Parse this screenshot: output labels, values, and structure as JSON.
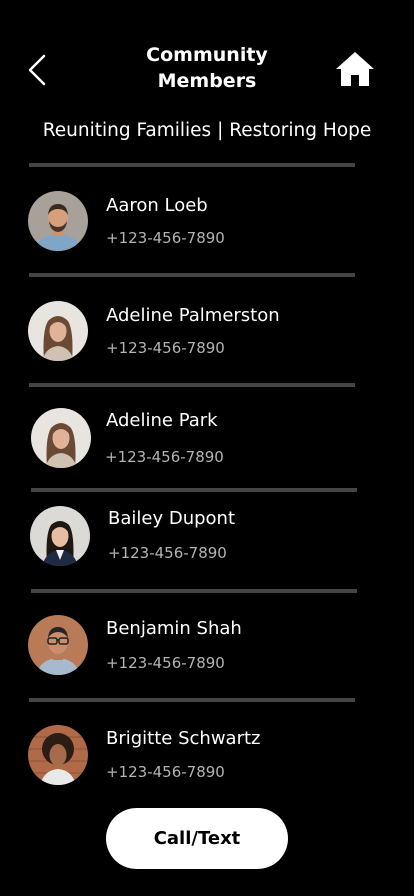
{
  "header": {
    "title_line1": "Community",
    "title_line2": "Members",
    "back_icon": "chevron-left-icon",
    "home_icon": "home-icon"
  },
  "tagline": "Reuniting Families | Restoring Hope",
  "members": [
    {
      "name": "Aaron Loeb",
      "phone": "+123-456-7890"
    },
    {
      "name": "Adeline Palmerston",
      "phone": "+123-456-7890"
    },
    {
      "name": "Adeline Park",
      "phone": "+123-456-7890"
    },
    {
      "name": "Bailey Dupont",
      "phone": "+123-456-7890"
    },
    {
      "name": "Benjamin Shah",
      "phone": "+123-456-7890"
    },
    {
      "name": "Brigitte Schwartz",
      "phone": "+123-456-7890"
    }
  ],
  "cta_label": "Call/Text",
  "colors": {
    "background": "#000000",
    "text": "#ffffff",
    "phone_text": "#b3b3b3",
    "divider": "#444444",
    "button_bg": "#ffffff",
    "button_text": "#000000"
  }
}
